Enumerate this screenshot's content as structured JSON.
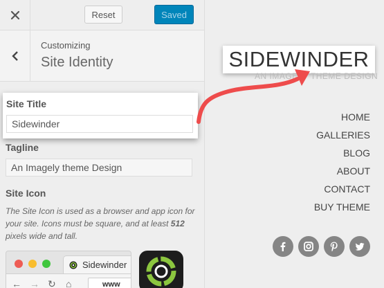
{
  "topbar": {
    "reset_label": "Reset",
    "saved_label": "Saved"
  },
  "section": {
    "customizing": "Customizing",
    "title": "Site Identity"
  },
  "site_title": {
    "label": "Site Title",
    "value": "Sidewinder"
  },
  "tagline": {
    "label": "Tagline",
    "value": "An Imagely theme Design"
  },
  "site_icon": {
    "label": "Site Icon",
    "desc_before": "The Site Icon is used as a browser and app icon for your site. Icons must be square, and at least ",
    "desc_bold": "512",
    "desc_after": " pixels wide and tall."
  },
  "browser_preview": {
    "tab_title": "Sidewinder",
    "url": "www"
  },
  "site": {
    "title": "SIDEWINDER",
    "tagline": "An Imagely theme Design",
    "nav": [
      "HOME",
      "GALLERIES",
      "BLOG",
      "ABOUT",
      "CONTACT",
      "BUY THEME"
    ]
  },
  "social_icons": [
    "facebook-icon",
    "instagram-icon",
    "pinterest-icon",
    "twitter-icon"
  ],
  "colors": {
    "accent": "#0085ba",
    "arrow": "#ee4c4c",
    "social": "#858585"
  }
}
